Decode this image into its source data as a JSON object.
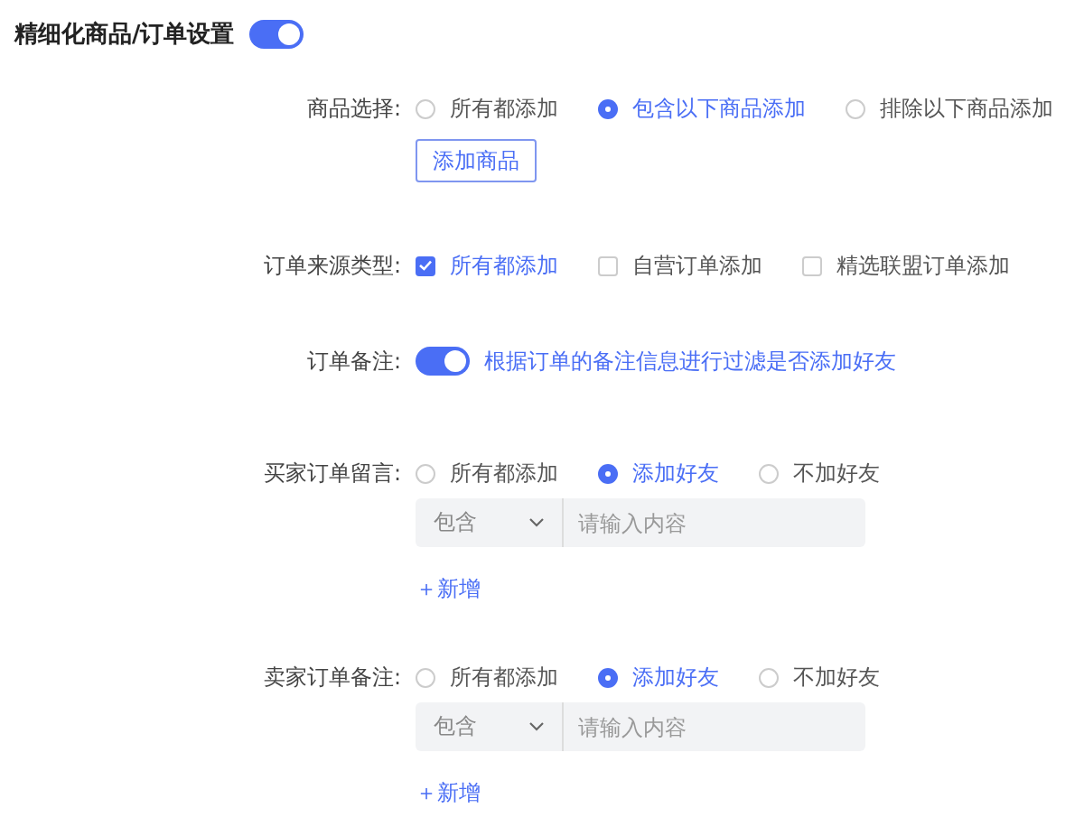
{
  "header": {
    "title": "精细化商品/订单设置",
    "on": true
  },
  "fields": [
    {
      "kind": "radio",
      "label": "商品选择:",
      "options": [
        {
          "label": "所有都添加",
          "selected": false
        },
        {
          "label": "包含以下商品添加",
          "selected": true
        },
        {
          "label": "排除以下商品添加",
          "selected": false
        }
      ],
      "button": "添加商品"
    },
    {
      "kind": "checkbox",
      "label": "订单来源类型:",
      "options": [
        {
          "label": "所有都添加",
          "checked": true
        },
        {
          "label": "自营订单添加",
          "checked": false
        },
        {
          "label": "精选联盟订单添加",
          "checked": false
        }
      ]
    },
    {
      "kind": "switch",
      "label": "订单备注:",
      "on": true,
      "hint": "根据订单的备注信息进行过滤是否添加好友"
    },
    {
      "kind": "radio",
      "label": "买家订单留言:",
      "options": [
        {
          "label": "所有都添加",
          "selected": false
        },
        {
          "label": "添加好友",
          "selected": true
        },
        {
          "label": "不加好友",
          "selected": false
        }
      ],
      "filter": {
        "condition": "包含",
        "placeholder": "请输入内容"
      },
      "add": "＋新增"
    },
    {
      "kind": "radio",
      "label": "卖家订单备注:",
      "options": [
        {
          "label": "所有都添加",
          "selected": false
        },
        {
          "label": "添加好友",
          "selected": true
        },
        {
          "label": "不加好友",
          "selected": false
        }
      ],
      "filter": {
        "condition": "包含",
        "placeholder": "请输入内容"
      },
      "add": "＋新增"
    }
  ]
}
